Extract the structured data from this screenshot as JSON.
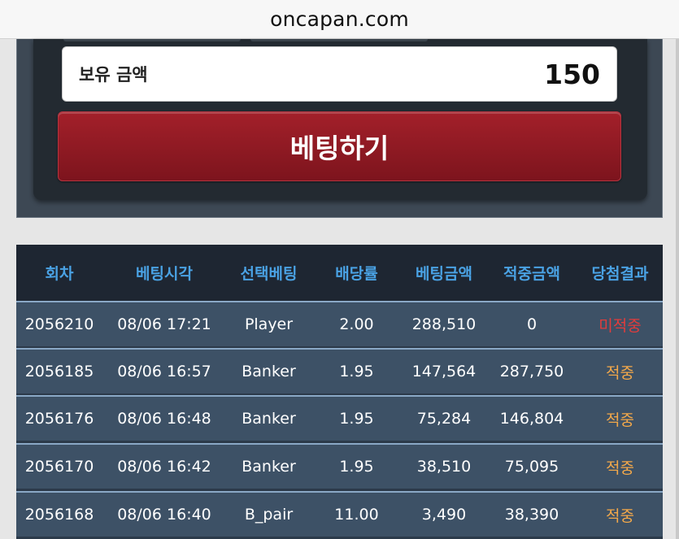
{
  "browser": {
    "url": "oncapan.com"
  },
  "bet_panel": {
    "balance_label": "보유 금액",
    "balance_value": "150",
    "bet_button_label": "베팅하기"
  },
  "history": {
    "columns": [
      "회차",
      "베팅시각",
      "선택베팅",
      "배당률",
      "베팅금액",
      "적중금액",
      "당첨결과"
    ],
    "rows": [
      {
        "round": "2056210",
        "time": "08/06 17:21",
        "choice": "Player",
        "odds": "2.00",
        "bet": "288,510",
        "win": "0",
        "result": "미적중",
        "status": "miss"
      },
      {
        "round": "2056185",
        "time": "08/06 16:57",
        "choice": "Banker",
        "odds": "1.95",
        "bet": "147,564",
        "win": "287,750",
        "result": "적중",
        "status": "hit"
      },
      {
        "round": "2056176",
        "time": "08/06 16:48",
        "choice": "Banker",
        "odds": "1.95",
        "bet": "75,284",
        "win": "146,804",
        "result": "적중",
        "status": "hit"
      },
      {
        "round": "2056170",
        "time": "08/06 16:42",
        "choice": "Banker",
        "odds": "1.95",
        "bet": "38,510",
        "win": "75,095",
        "result": "적중",
        "status": "hit"
      },
      {
        "round": "2056168",
        "time": "08/06 16:40",
        "choice": "B_pair",
        "odds": "11.00",
        "bet": "3,490",
        "win": "38,390",
        "result": "적중",
        "status": "hit"
      }
    ]
  },
  "colors": {
    "header_text": "#4aa2e4",
    "result_miss": "#e23c3c",
    "result_hit": "#f2a84a",
    "bet_button": "#8f1a23"
  }
}
